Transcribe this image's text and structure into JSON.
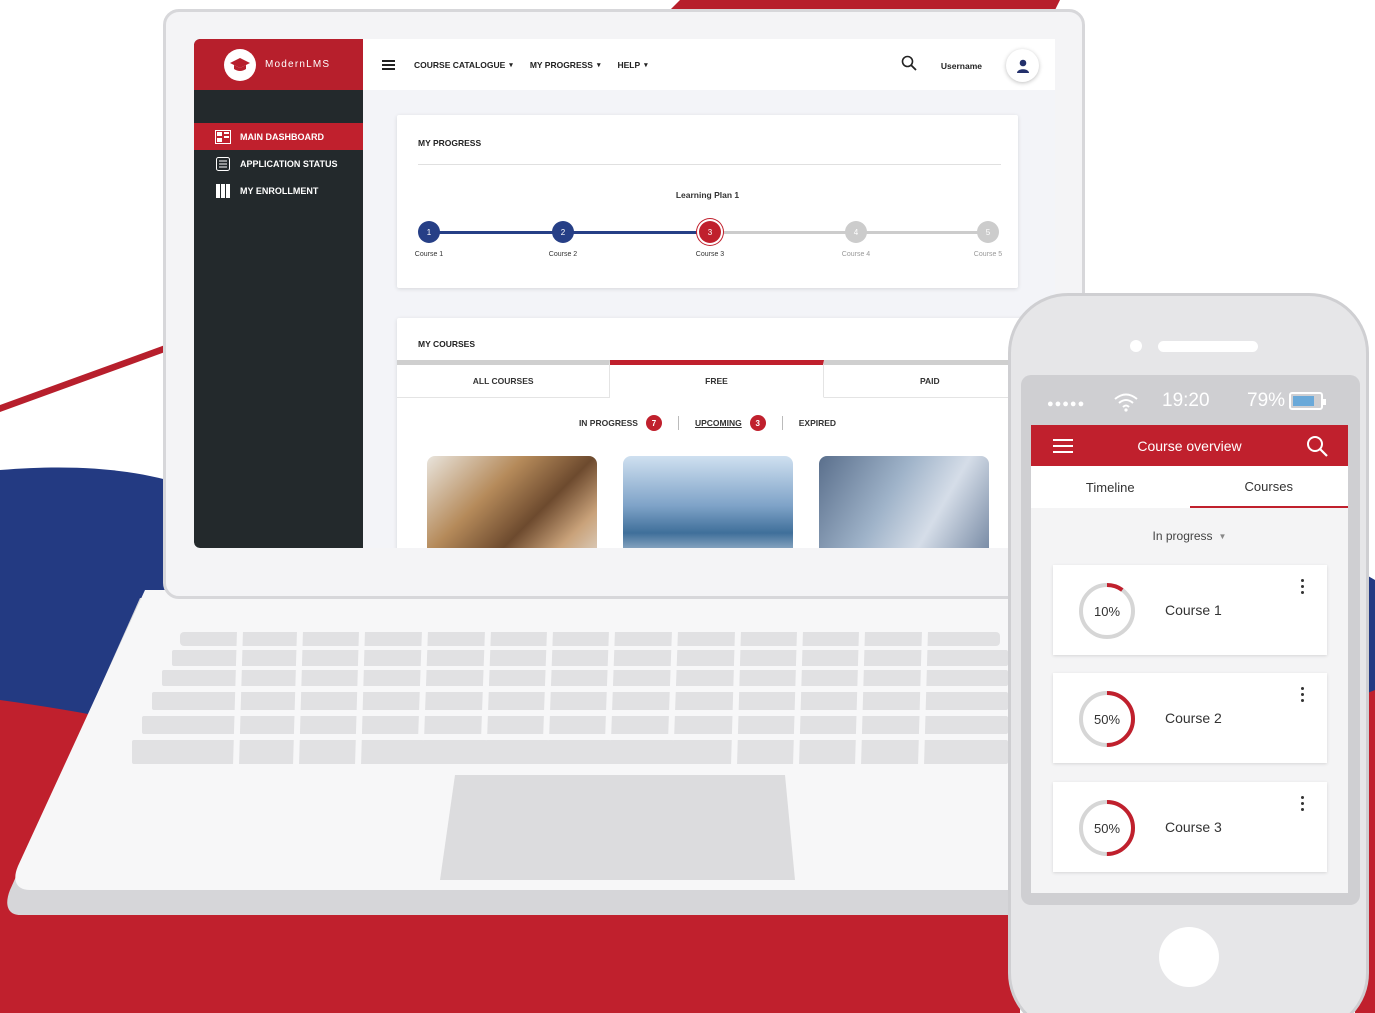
{
  "colors": {
    "brand_red": "#c0202d",
    "sidebar_dark": "#23292c",
    "step_blue": "#263f86",
    "step_grey": "#cccccc"
  },
  "sidebar": {
    "brand_name": "ModernLMS",
    "items": [
      {
        "label": "MAIN DASHBOARD",
        "icon": "dashboard-icon",
        "active": true
      },
      {
        "label": "APPLICATION STATUS",
        "icon": "list-icon",
        "active": false
      },
      {
        "label": "MY ENROLLMENT",
        "icon": "books-icon",
        "active": false
      }
    ]
  },
  "topbar": {
    "menu": [
      {
        "label": "COURSE CATALOGUE"
      },
      {
        "label": "MY PROGRESS"
      },
      {
        "label": "HELP"
      }
    ],
    "username": "Username"
  },
  "my_progress": {
    "title": "MY PROGRESS",
    "plan": "Learning Plan 1",
    "steps": [
      {
        "number": "1",
        "label": "Course 1",
        "state": "done"
      },
      {
        "number": "2",
        "label": "Course 2",
        "state": "done"
      },
      {
        "number": "3",
        "label": "Course 3",
        "state": "current"
      },
      {
        "number": "4",
        "label": "Course 4",
        "state": "todo"
      },
      {
        "number": "5",
        "label": "Course 5",
        "state": "todo"
      }
    ]
  },
  "my_courses": {
    "title": "MY COURSES",
    "tabs": [
      {
        "label": "ALL COURSES",
        "active": false
      },
      {
        "label": "FREE",
        "active": true
      },
      {
        "label": "PAID",
        "active": false
      }
    ],
    "filters": [
      {
        "label": "IN PROGRESS",
        "count": "7"
      },
      {
        "label": "UPCOMING",
        "count": "3"
      },
      {
        "label": "EXPIRED",
        "count": ""
      }
    ]
  },
  "phone": {
    "time": "19:20",
    "battery": "79%",
    "battery_level": 0.79,
    "app_title": "Course overview",
    "tabs": [
      {
        "label": "Timeline",
        "active": false
      },
      {
        "label": "Courses",
        "active": true
      }
    ],
    "filter": "In progress",
    "courses": [
      {
        "name": "Course 1",
        "progress_label": "10%",
        "progress": 0.1
      },
      {
        "name": "Course 2",
        "progress_label": "50%",
        "progress": 0.5
      },
      {
        "name": "Course 3",
        "progress_label": "50%",
        "progress": 0.5
      }
    ]
  }
}
